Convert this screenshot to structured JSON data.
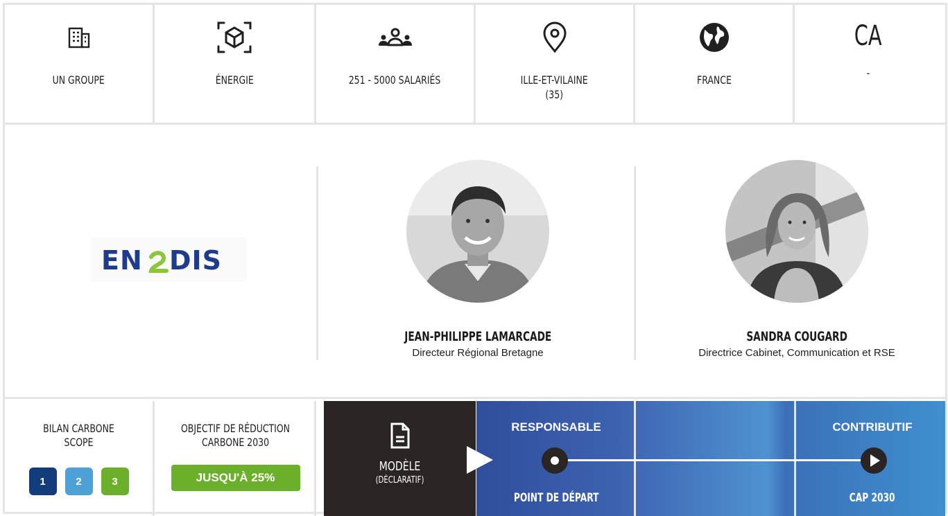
{
  "stats": [
    {
      "icon": "building-icon",
      "label": "UN GROUPE"
    },
    {
      "icon": "cube-icon",
      "label": "ÉNERGIE"
    },
    {
      "icon": "people-icon",
      "label": "251 - 5000 SALARIÉS"
    },
    {
      "icon": "location-pin-icon",
      "label": "ILLE-ET-VILAINE\n(35)"
    },
    {
      "icon": "globe-icon",
      "label": "FRANCE"
    },
    {
      "icon": "revenue-text",
      "big": "CA",
      "label": "-"
    }
  ],
  "logo": {
    "text": "ENEDIS",
    "colors": [
      "#1f3c8c",
      "#8cc63f"
    ]
  },
  "people": [
    {
      "name": "JEAN-PHILIPPE LAMARCADE",
      "role": "Directeur Régional Bretagne"
    },
    {
      "name": "SANDRA COUGARD",
      "role": "Directrice Cabinet, Communication et RSE"
    }
  ],
  "bilan": {
    "title": "BILAN CARBONE\nSCOPE",
    "scopes": [
      {
        "label": "1",
        "color": "#123c7c"
      },
      {
        "label": "2",
        "color": "#4ea1d6"
      },
      {
        "label": "3",
        "color": "#6bb02a"
      }
    ]
  },
  "objective": {
    "title": "OBJECTIF DE RÉDUCTION\nCARBONE 2030",
    "badge": "JUSQU'À 25%"
  },
  "model": {
    "title": "MODÈLE",
    "subtitle": "(DÉCLARATIF)"
  },
  "scale": {
    "left_top": "RESPONSABLE",
    "left_bottom": "POINT DE DÉPART",
    "right_top": "CONTRIBUTIF",
    "right_bottom": "CAP 2030"
  }
}
